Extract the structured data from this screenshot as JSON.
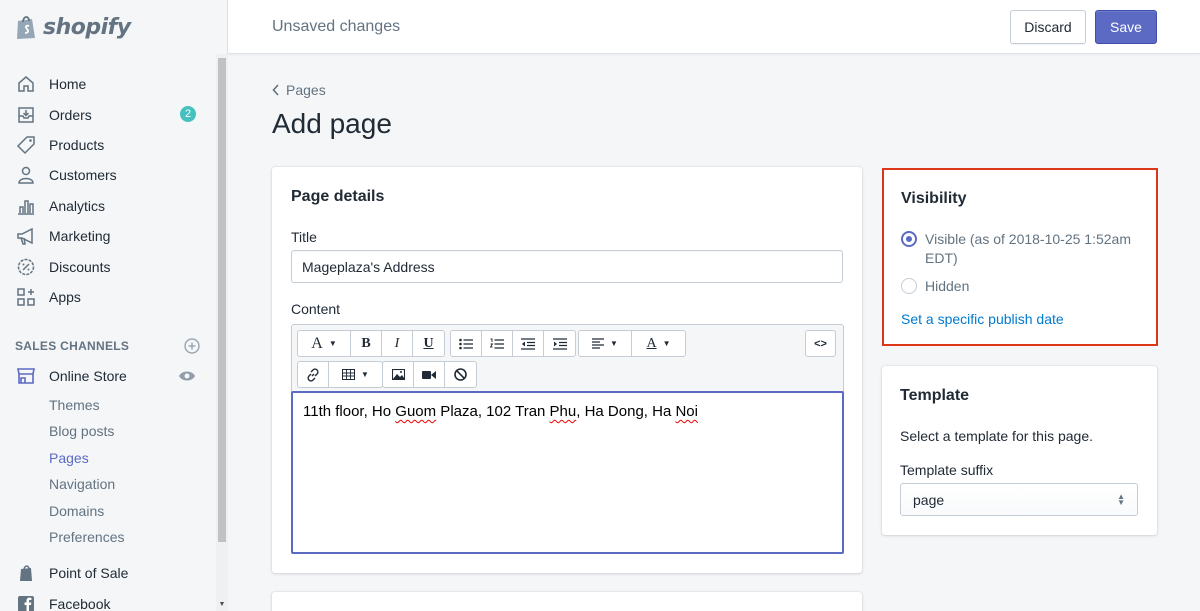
{
  "brand": {
    "name": "shopify"
  },
  "topbar": {
    "status": "Unsaved changes",
    "discard_label": "Discard",
    "save_label": "Save"
  },
  "sidebar": {
    "items": [
      {
        "label": "Home",
        "icon": "home-icon"
      },
      {
        "label": "Orders",
        "icon": "orders-icon",
        "badge": "2"
      },
      {
        "label": "Products",
        "icon": "tag-icon"
      },
      {
        "label": "Customers",
        "icon": "person-icon"
      },
      {
        "label": "Analytics",
        "icon": "bar-chart-icon"
      },
      {
        "label": "Marketing",
        "icon": "megaphone-icon"
      },
      {
        "label": "Discounts",
        "icon": "discount-icon"
      },
      {
        "label": "Apps",
        "icon": "apps-icon"
      }
    ],
    "sales_channels_title": "SALES CHANNELS",
    "online_store": {
      "label": "Online Store",
      "sub_items": [
        "Themes",
        "Blog posts",
        "Pages",
        "Navigation",
        "Domains",
        "Preferences"
      ],
      "active": "Pages"
    },
    "bottom_items": [
      {
        "label": "Point of Sale",
        "icon": "pos-icon"
      },
      {
        "label": "Facebook",
        "icon": "facebook-icon"
      }
    ]
  },
  "main": {
    "breadcrumb": "Pages",
    "title": "Add page",
    "details": {
      "heading": "Page details",
      "title_label": "Title",
      "title_value": "Mageplaza's Address",
      "content_label": "Content",
      "content_text": {
        "p1": "11th floor, Ho ",
        "w1": "Guom",
        "p2": " Plaza, 102 Tran ",
        "w2": "Phu",
        "p3": ", Ha Dong, Ha ",
        "w3": "Noi"
      },
      "toolbar": {
        "font": "A",
        "bold": "B",
        "italic": "I",
        "underline": "U",
        "color": "A",
        "html": "<>"
      }
    },
    "visibility": {
      "heading": "Visibility",
      "visible_label": "Visible (as of 2018-10-25 1:52am EDT)",
      "hidden_label": "Hidden",
      "selected": "visible",
      "publish_link": "Set a specific publish date"
    },
    "template": {
      "heading": "Template",
      "hint": "Select a template for this page.",
      "suffix_label": "Template suffix",
      "suffix_value": "page"
    }
  },
  "colors": {
    "accent": "#5c6ac4",
    "badge": "#47c1bf",
    "highlight_border": "#de3618",
    "link": "#007ace"
  }
}
